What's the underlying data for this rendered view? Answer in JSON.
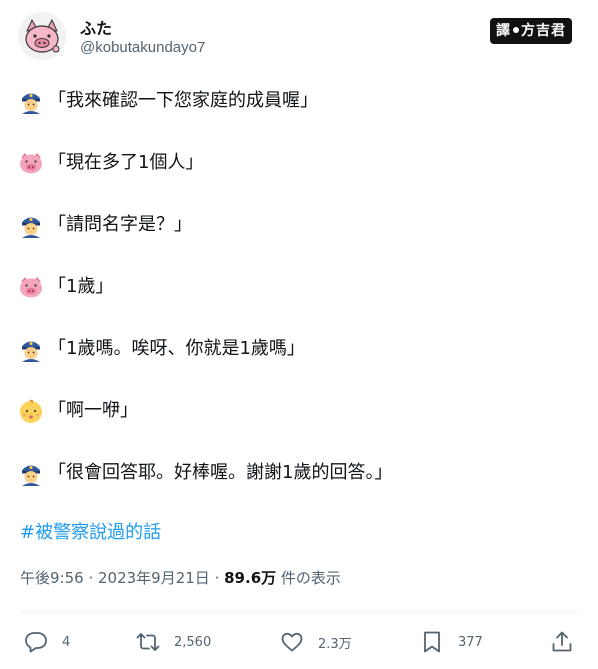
{
  "user": {
    "display_name": "ふた",
    "handle": "@kobutakundayo7",
    "avatar_icon": "pig-avatar-icon"
  },
  "stamp": {
    "left_text": "譯",
    "right_text": "方吉君"
  },
  "lines": [
    {
      "icon": "police-officer-icon",
      "text": "「我來確認一下您家庭的成員喔」"
    },
    {
      "icon": "pig-face-icon",
      "text": "「現在多了1個人」"
    },
    {
      "icon": "police-officer-icon",
      "text": "「請問名字是？」"
    },
    {
      "icon": "pig-face-icon",
      "text": "「1歲」"
    },
    {
      "icon": "police-officer-icon",
      "text": "「1歲嗎。唉呀、你就是1歲嗎」"
    },
    {
      "icon": "baby-face-icon",
      "text": "「啊一咿」"
    },
    {
      "icon": "police-officer-icon",
      "text": "「很會回答耶。好棒喔。謝謝1歲的回答。」"
    }
  ],
  "hashtag": "#被警察說過的話",
  "meta": {
    "time": "午後9:56",
    "separator": " · ",
    "date": "2023年9月21日",
    "views_count": "89.6万",
    "views_label": "件の表示"
  },
  "actions": {
    "replies": "4",
    "retweets": "2,560",
    "likes": "2.3万",
    "bookmarks": "377"
  },
  "colors": {
    "text": "#0f1419",
    "secondary": "#536471",
    "hashtag": "#1d9bf0"
  }
}
